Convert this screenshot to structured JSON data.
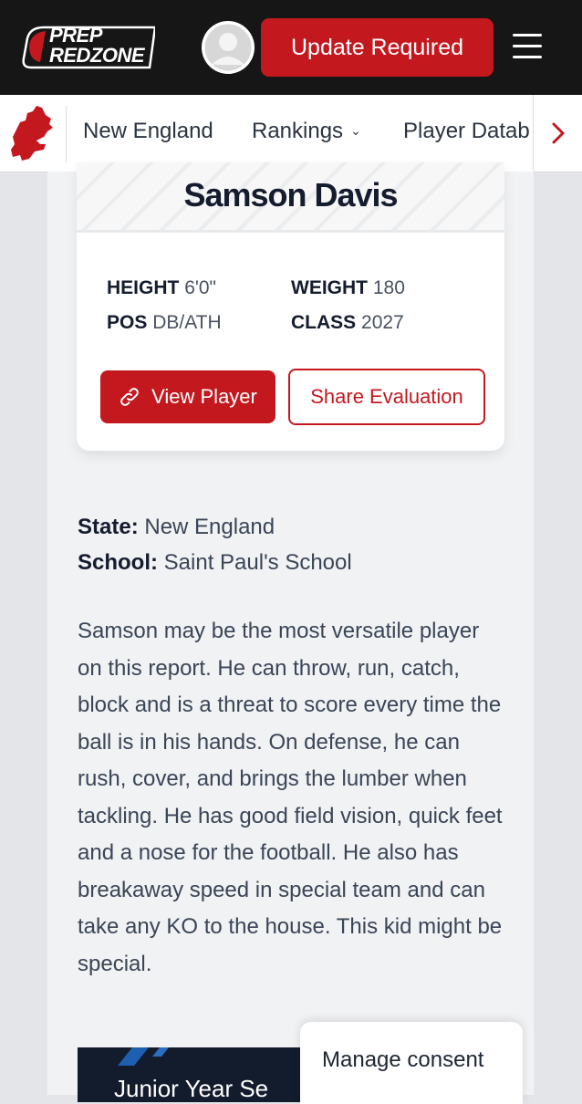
{
  "header": {
    "logo_line1": "PREP",
    "logo_line2": "REDZONE",
    "update_button": "Update Required",
    "menu_icon": "hamburger-menu-icon",
    "colors": {
      "bar": "#161616",
      "accent": "#c4181f"
    }
  },
  "nav": {
    "map_icon": "new-england-map-icon",
    "items": [
      "New England",
      "Rankings",
      "Player Datab"
    ],
    "rankings_chevron": "⌄",
    "next_icon": "chevron-right-icon"
  },
  "player": {
    "name": "Samson Davis",
    "height_label": "HEIGHT",
    "height_value": "6'0\"",
    "weight_label": "WEIGHT",
    "weight_value": "180",
    "pos_label": "POS",
    "pos_value": "DB/ATH",
    "class_label": "CLASS",
    "class_value": "2027",
    "view_button": "View Player",
    "share_button": "Share Evaluation"
  },
  "details": {
    "state_label": "State:",
    "state_value": "New England",
    "school_label": "School:",
    "school_value": "Saint Paul's School"
  },
  "bio": "Samson may be the most versatile player on this report. He can throw, run, catch, block and is a threat to score every time the ball is in his hands. On defense, he can rush, cover, and brings the lumber when tackling. He has good field vision, quick feet and a nose for the football. He also has breakaway speed in special team and can take any KO to the house. This kid might be special.",
  "video": {
    "title": "Junior Year Se"
  },
  "consent": {
    "label": "Manage consent"
  }
}
